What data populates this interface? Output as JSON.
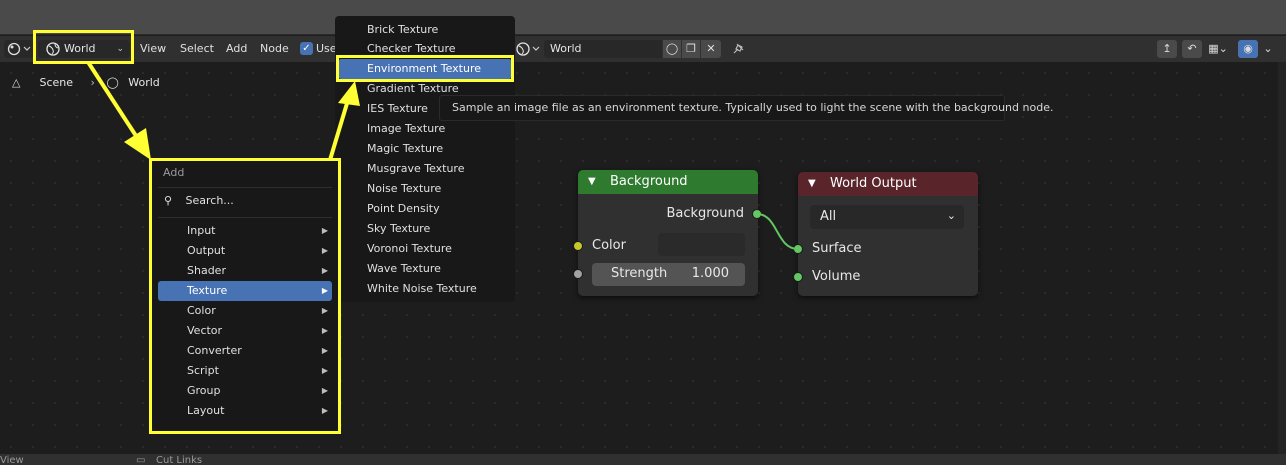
{
  "header": {
    "world_label": "World",
    "menus": [
      "View",
      "Select",
      "Add",
      "Node"
    ],
    "use_label": "Use",
    "world_field_value": "World"
  },
  "breadcrumb": {
    "scene": "Scene",
    "world": "World"
  },
  "add_menu": {
    "title": "Add",
    "search_label": "Search...",
    "items": [
      {
        "label": "Input"
      },
      {
        "label": "Output"
      },
      {
        "label": "Shader"
      },
      {
        "label": "Texture"
      },
      {
        "label": "Color"
      },
      {
        "label": "Vector"
      },
      {
        "label": "Converter"
      },
      {
        "label": "Script"
      },
      {
        "label": "Group"
      },
      {
        "label": "Layout"
      }
    ],
    "active_item": "Texture"
  },
  "texture_menu": {
    "items": [
      {
        "label": "Brick Texture"
      },
      {
        "label": "Checker Texture"
      },
      {
        "label": "Environment Texture"
      },
      {
        "label": "Gradient Texture"
      },
      {
        "label": "IES Texture"
      },
      {
        "label": "Image Texture"
      },
      {
        "label": "Magic Texture"
      },
      {
        "label": "Musgrave Texture"
      },
      {
        "label": "Noise Texture"
      },
      {
        "label": "Point Density"
      },
      {
        "label": "Sky Texture"
      },
      {
        "label": "Voronoi Texture"
      },
      {
        "label": "Wave Texture"
      },
      {
        "label": "White Noise Texture"
      }
    ],
    "active_item": "Environment Texture"
  },
  "tooltip": "Sample an image file as an environment texture. Typically used to light the scene with the background node.",
  "background_node": {
    "title": "Background",
    "output_label": "Background",
    "color_label": "Color",
    "strength_label": "Strength",
    "strength_value": "1.000",
    "header_color": "#2e7a2e"
  },
  "world_output_node": {
    "title": "World Output",
    "target_value": "All",
    "surface_label": "Surface",
    "volume_label": "Volume",
    "header_color": "#6e2a32"
  },
  "status_bar": {
    "left_text": "View",
    "mid_text": "Cut Links"
  },
  "colors": {
    "highlight": "#ffff33",
    "accent": "#4772b3",
    "socket_shader": "#63c763",
    "socket_color": "#c7c729",
    "socket_value": "#a1a1a1"
  }
}
